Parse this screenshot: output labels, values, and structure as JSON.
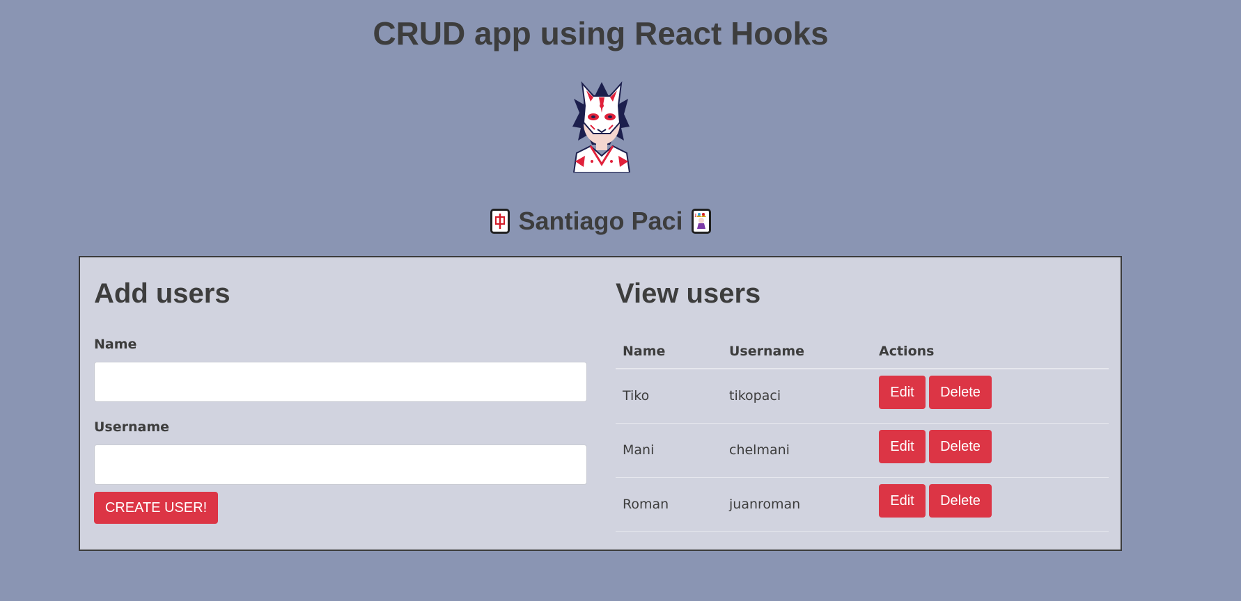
{
  "header": {
    "title": "CRUD app using React Hooks",
    "author_name": "Santiago Paci",
    "left_tile_icon": "mahjong-red-dragon-icon",
    "right_tile_icon": "joker-card-icon"
  },
  "avatar": {
    "icon": "kitsune-mask-avatar-icon"
  },
  "add_users": {
    "title": "Add users",
    "name_label": "Name",
    "name_value": "",
    "username_label": "Username",
    "username_value": "",
    "submit_label": "CREATE USER!"
  },
  "view_users": {
    "title": "View users",
    "columns": [
      "Name",
      "Username",
      "Actions"
    ],
    "rows": [
      {
        "name": "Tiko",
        "username": "tikopaci",
        "edit_label": "Edit",
        "delete_label": "Delete"
      },
      {
        "name": "Mani",
        "username": "chelmani",
        "edit_label": "Edit",
        "delete_label": "Delete"
      },
      {
        "name": "Roman",
        "username": "juanroman",
        "edit_label": "Edit",
        "delete_label": "Delete"
      }
    ]
  },
  "colors": {
    "background": "#8a95b3",
    "panel": "#d1d3df",
    "accent": "#dc3545",
    "text": "#3d3d3d"
  }
}
